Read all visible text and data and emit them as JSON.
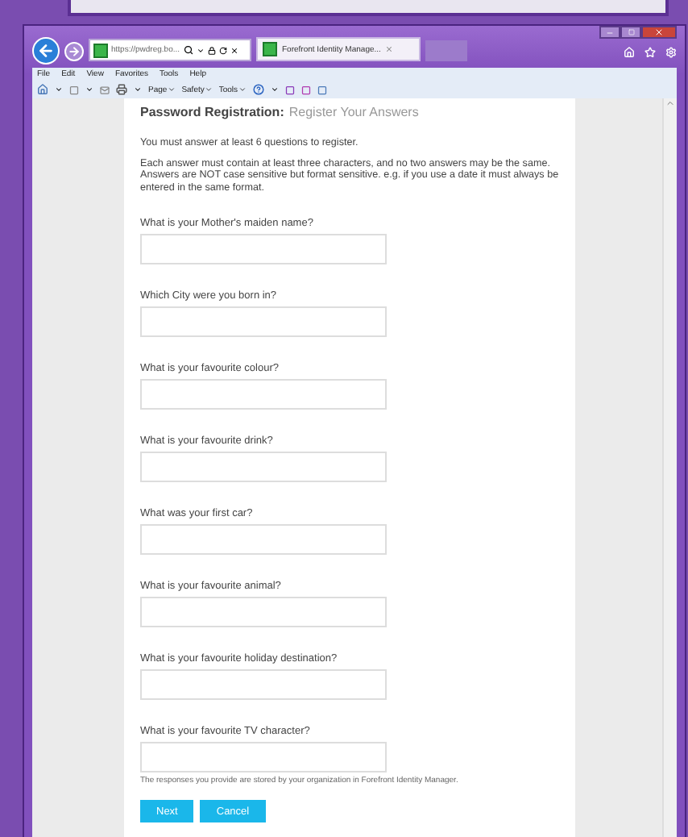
{
  "browser": {
    "address": "https://pwdreg.bo...",
    "tabs": [
      {
        "title": "Forefront Identity Manage...",
        "selected": true
      }
    ],
    "menu": [
      "File",
      "Edit",
      "View",
      "Favorites",
      "Tools",
      "Help"
    ],
    "commands": [
      "Page",
      "Safety",
      "Tools"
    ]
  },
  "page": {
    "title": "Password Registration:",
    "subtitle": "Register Your Answers",
    "intro": "You must answer at least 6 questions to register.",
    "rules": "Each answer must contain at least three characters, and no two answers may be the same. Answers are NOT case sensitive but format sensitive. e.g. if you use a date it must always be entered in the same format.",
    "questions": [
      {
        "label": "What is your Mother's maiden name?"
      },
      {
        "label": "Which City were you born in?"
      },
      {
        "label": "What is your favourite colour?"
      },
      {
        "label": "What is your favourite drink?"
      },
      {
        "label": "What was your first car?"
      },
      {
        "label": "What is your favourite animal?"
      },
      {
        "label": "What is your favourite holiday destination?"
      },
      {
        "label": "What is your favourite TV character?"
      }
    ],
    "note": "The responses you provide are stored by your organization in Forefront Identity Manager.",
    "buttons": [
      {
        "label": "Next"
      },
      {
        "label": "Cancel"
      }
    ]
  }
}
